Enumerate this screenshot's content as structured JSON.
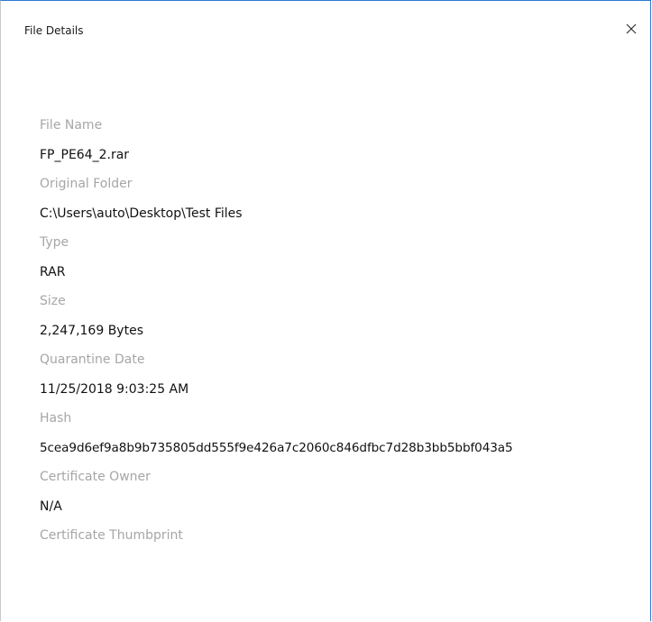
{
  "window": {
    "title": "File Details"
  },
  "details": [
    {
      "label": "File Name",
      "value": "FP_PE64_2.rar"
    },
    {
      "label": "Original Folder",
      "value": "C:\\Users\\auto\\Desktop\\Test Files"
    },
    {
      "label": "Type",
      "value": "RAR"
    },
    {
      "label": "Size",
      "value": "2,247,169 Bytes"
    },
    {
      "label": "Quarantine Date",
      "value": "11/25/2018 9:03:25 AM"
    },
    {
      "label": "Hash",
      "value": "5cea9d6ef9a8b9b735805dd555f9e426a7c2060c846dfbc7d28b3bb5bbf043a5"
    },
    {
      "label": "Certificate Owner",
      "value": "N/A"
    },
    {
      "label": "Certificate Thumbprint",
      "value": ""
    }
  ],
  "icons": {
    "close": "close-icon"
  }
}
